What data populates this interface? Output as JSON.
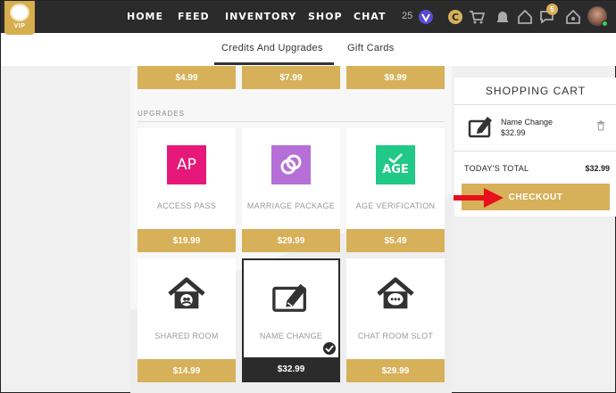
{
  "nav": {
    "badge_text": "VIP",
    "items": [
      "HOME",
      "FEED",
      "INVENTORY",
      "SHOP",
      "CHAT"
    ],
    "coin_count": "25",
    "notification_count": "5",
    "icons": [
      "vip-v-icon",
      "currency-c-icon",
      "cart-icon",
      "bell-icon",
      "house-icon",
      "chat-bubble-icon",
      "avatar"
    ]
  },
  "tabs": [
    "Credits And Upgrades",
    "Gift Cards"
  ],
  "credits": {
    "prices": [
      "$4.99",
      "$7.99",
      "$9.99"
    ]
  },
  "upgrades": {
    "section_label": "UPGRADES",
    "cards": [
      {
        "name": "ACCESS PASS",
        "price": "$19.99",
        "icon_text": "AP",
        "color": "#e6197a"
      },
      {
        "name": "MARRIAGE PACKAGE",
        "price": "$29.99",
        "icon": "rings-icon",
        "color": "#b56fd6"
      },
      {
        "name": "AGE VERIFICATION",
        "price": "$5.49",
        "icon_text": "AGE",
        "color": "#21c986"
      },
      {
        "name": "SHARED ROOM",
        "price": "$14.99",
        "icon": "shared-house-icon"
      },
      {
        "name": "NAME CHANGE",
        "price": "$32.99",
        "icon": "edit-card-icon",
        "selected": true
      },
      {
        "name": "CHAT ROOM SLOT",
        "price": "$29.99",
        "icon": "chat-house-icon"
      }
    ]
  },
  "cart": {
    "title": "SHOPPING CART",
    "item_name": "Name Change",
    "item_price": "$32.99",
    "total_label": "TODAY'S TOTAL",
    "total_value": "$32.99",
    "checkout_label": "CHECKOUT"
  },
  "colors": {
    "accent_gold": "#d7b05a",
    "nav_dark": "#2b2b2b",
    "arrow_red": "#e8101a"
  }
}
